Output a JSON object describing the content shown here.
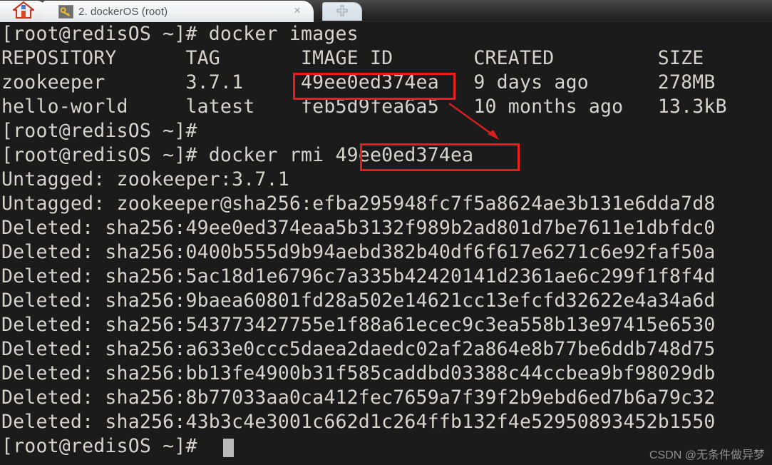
{
  "window": {
    "tabs": [
      {
        "name": "home-tab",
        "label": "",
        "icon": "home-icon"
      },
      {
        "name": "session-tab",
        "label": "2. dockerOS (root)",
        "icon": "key-icon",
        "active": true
      }
    ],
    "close_label": "×",
    "new_tab_label": "+"
  },
  "terminal": {
    "prompt": "[root@redisOS ~]#",
    "cursor_visible": true,
    "lines": [
      "[root@redisOS ~]# docker images",
      "REPOSITORY      TAG       IMAGE ID       CREATED         SIZE",
      "zookeeper       3.7.1     49ee0ed374ea   9 days ago      278MB",
      "hello-world     latest    feb5d9fea6a5   10 months ago   13.3kB",
      "[root@redisOS ~]#",
      "[root@redisOS ~]# docker rmi 49ee0ed374ea",
      "Untagged: zookeeper:3.7.1",
      "Untagged: zookeeper@sha256:efba295948fc7f5a8624ae3b131e6dda7d8",
      "Deleted: sha256:49ee0ed374eaa5b3132f989b2ad801d7be7611e1dbfdc0",
      "Deleted: sha256:0400b555d9b94aebd382b40df6f617e6271c6e92faf50a",
      "Deleted: sha256:5ac18d1e6796c7a335b42420141d2361ae6c299f1f8f4d",
      "Deleted: sha256:9baea60801fd28a502e14621cc13efcfd32622e4a34a6d",
      "Deleted: sha256:543773427755e1f88a61ecec9c3ea558b13e97415e6530",
      "Deleted: sha256:a633e0ccc5daea2daedc02af2a864e8b77be6ddb748d75",
      "Deleted: sha256:bb13fe4900b31f585caddbd03388c44ccbea9bf98029db",
      "Deleted: sha256:8b77033aa0ca412fec7659a7f39f2b9ebd6ed7b6a79c32",
      "Deleted: sha256:43b3c4e3001c662d1c264ffb132f4e52950893452b1550",
      "[root@redisOS ~]#"
    ]
  },
  "annotations": {
    "highlight_color": "#ee1b1b",
    "boxes": [
      {
        "name": "image-id-highlight",
        "text": "49ee0ed374ea"
      },
      {
        "name": "rmi-argument-highlight",
        "text": "49ee0ed374ea"
      }
    ],
    "arrow": {
      "name": "connector-arrow",
      "from": "image-id-highlight",
      "to": "rmi-argument-highlight"
    }
  },
  "watermark": {
    "text": "CSDN @无条件做异梦"
  }
}
